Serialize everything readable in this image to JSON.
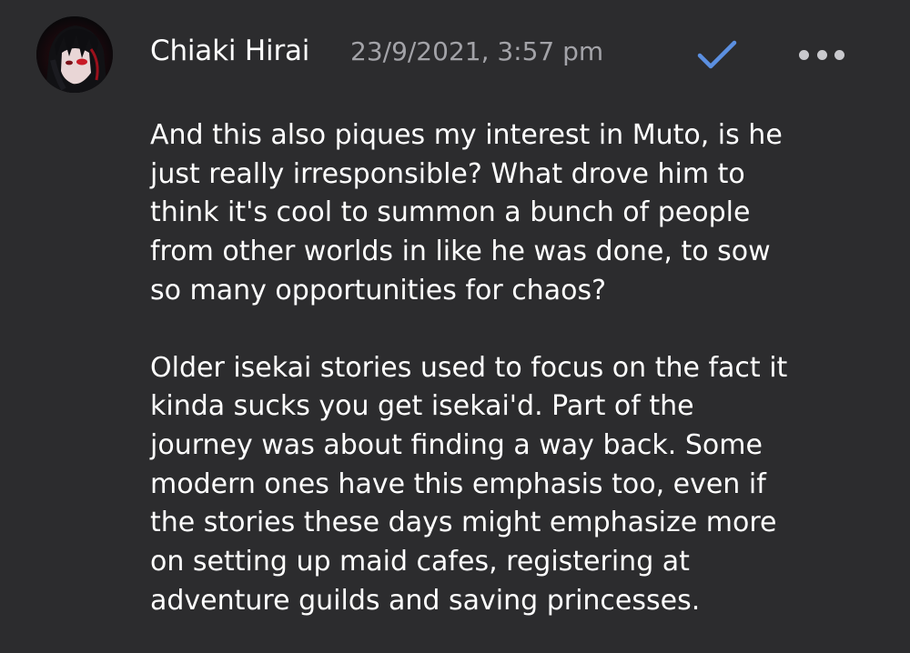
{
  "post": {
    "author": "Chiaki Hirai",
    "timestamp": "23/9/2021, 3:57 pm",
    "check_icon": "checkmark-icon",
    "more_icon": "more-horizontal-icon",
    "accent_color": "#5b8fe0",
    "paragraphs": [
      {
        "lines": [
          "And this also piques my interest in Muto, is he",
          "just really irresponsible? What drove him to",
          "think it's cool to summon a bunch of people",
          "from other worlds in like he was done, to sow",
          "so many opportunities for chaos?"
        ]
      },
      {
        "lines": [
          "Older isekai stories used to focus on the fact it",
          "kinda sucks you get isekai'd. Part of the",
          "journey was about finding a way back. Some",
          "modern ones have this emphasis too, even if",
          "the stories these days might emphasize more",
          "on setting up maid cafes, registering at",
          "adventure guilds and saving princesses."
        ]
      }
    ]
  }
}
